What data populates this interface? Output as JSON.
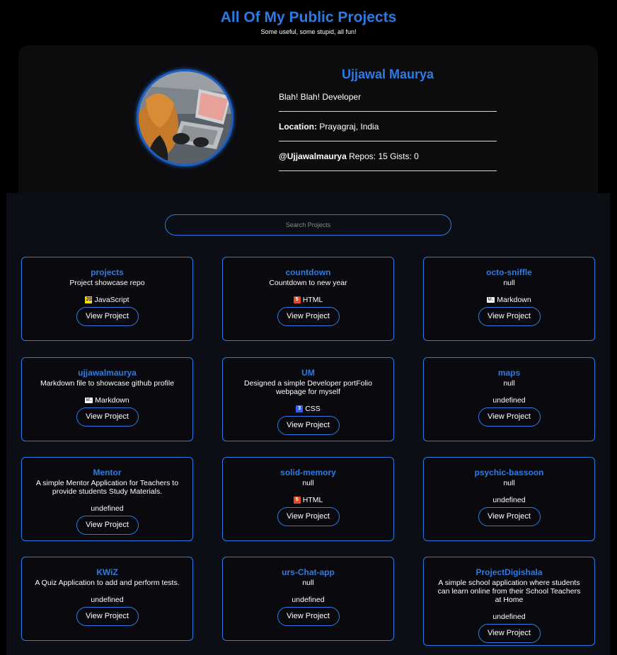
{
  "header": {
    "title": "All Of My Public Projects",
    "subtitle": "Some useful, some stupid, all fun!"
  },
  "profile": {
    "name": "Ujjawal Maurya",
    "bio": "Blah! Blah! Developer",
    "location_label": "Location:",
    "location": "Prayagraj, India",
    "username": "@Ujjawalmaurya",
    "stats": "Repos: 15 Gists: 0",
    "avatar_icon": "avatar-photo"
  },
  "search": {
    "placeholder": "Search Projects",
    "value": ""
  },
  "button_label": "View Project",
  "projects": [
    {
      "name": "projects",
      "description": "Project showcase repo",
      "language": "JavaScript",
      "icon": "js"
    },
    {
      "name": "countdown",
      "description": "Countdown to new year",
      "language": "HTML",
      "icon": "html"
    },
    {
      "name": "octo-sniffle",
      "description": "null",
      "language": "Markdown",
      "icon": "md"
    },
    {
      "name": "ujjawalmaurya",
      "description": "Markdown file to showcase github profile",
      "language": "Markdown",
      "icon": "md"
    },
    {
      "name": "UM",
      "description": "Designed a simple Developer portFolio webpage for myself",
      "language": "CSS",
      "icon": "css"
    },
    {
      "name": "maps",
      "description": "null",
      "language": "undefined",
      "icon": ""
    },
    {
      "name": "Mentor",
      "description": "A simple Mentor Application for Teachers to provide students Study Materials.",
      "language": "undefined",
      "icon": ""
    },
    {
      "name": "solid-memory",
      "description": "null",
      "language": "HTML",
      "icon": "html"
    },
    {
      "name": "psychic-bassoon",
      "description": "null",
      "language": "undefined",
      "icon": ""
    },
    {
      "name": "KWiZ",
      "description": "A Quiz Application to add and perform tests.",
      "language": "undefined",
      "icon": ""
    },
    {
      "name": "urs-Chat-app",
      "description": "null",
      "language": "undefined",
      "icon": ""
    },
    {
      "name": "ProjectDigishala",
      "description": "A simple school application where students can learn online from their School Teachers at Home",
      "language": "undefined",
      "icon": ""
    }
  ],
  "colors": {
    "accent": "#2c7be5",
    "background": "#000000",
    "card": "#0a0a0e"
  }
}
